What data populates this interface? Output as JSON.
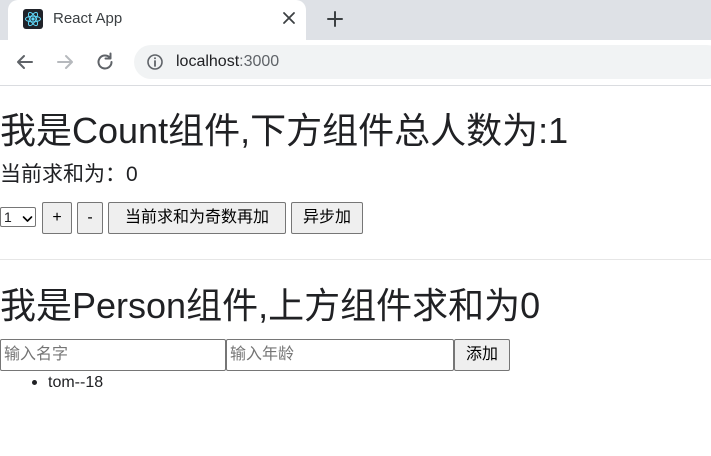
{
  "browser": {
    "tab": {
      "title": "React App",
      "favicon_icon": "react-logo-icon",
      "close_icon": "close-icon"
    },
    "new_tab_icon": "plus-icon",
    "nav": {
      "back_icon": "arrow-left-icon",
      "forward_icon": "arrow-right-icon",
      "reload_icon": "reload-icon"
    },
    "omnibox": {
      "info_icon": "info-icon",
      "host": "localhost",
      "port": ":3000"
    }
  },
  "count_component": {
    "heading": "我是Count组件,下方组件总人数为:1",
    "sum_text": "当前求和为：0",
    "select_value": "1",
    "buttons": {
      "increment": "+",
      "decrement": "-",
      "odd_increment": "当前求和为奇数再加",
      "async_increment": "异步加"
    }
  },
  "person_component": {
    "heading": "我是Person组件,上方组件求和为0",
    "name_placeholder": "输入名字",
    "age_placeholder": "输入年龄",
    "add_button": "添加",
    "persons": [
      {
        "label": "tom--18"
      }
    ]
  }
}
